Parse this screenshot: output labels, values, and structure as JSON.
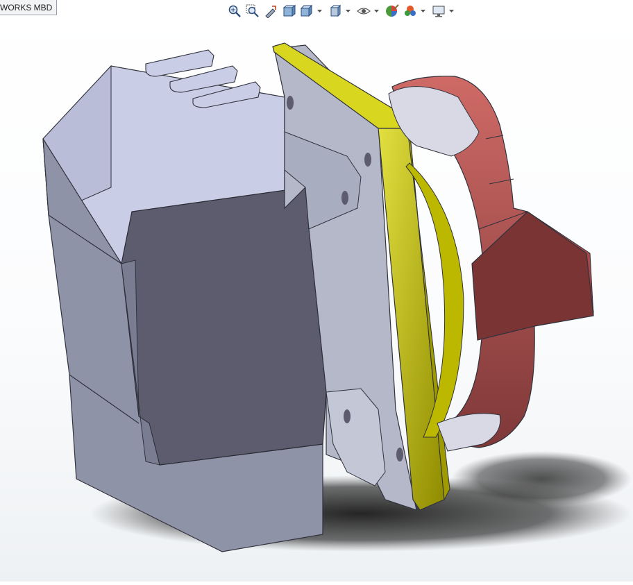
{
  "tab": {
    "label": "WORKS MBD"
  },
  "toolbar": {
    "buttons": [
      {
        "icon": "zoom-to-fit-icon"
      },
      {
        "icon": "zoom-to-area-icon"
      },
      {
        "icon": "previous-view-icon"
      },
      {
        "icon": "section-view-icon"
      },
      {
        "icon": "view-orientation-icon"
      },
      {
        "icon": "display-style-icon"
      },
      {
        "icon": "hide-show-items-icon"
      },
      {
        "icon": "edit-appearance-icon"
      },
      {
        "icon": "apply-scene-icon"
      },
      {
        "icon": "view-settings-icon"
      }
    ]
  },
  "colors": {
    "housing": "#8c90a8",
    "housing_dark": "#5a5a6c",
    "plate": "#c8c400",
    "knob": "#c25c5c",
    "knob_dark": "#7a3434"
  }
}
